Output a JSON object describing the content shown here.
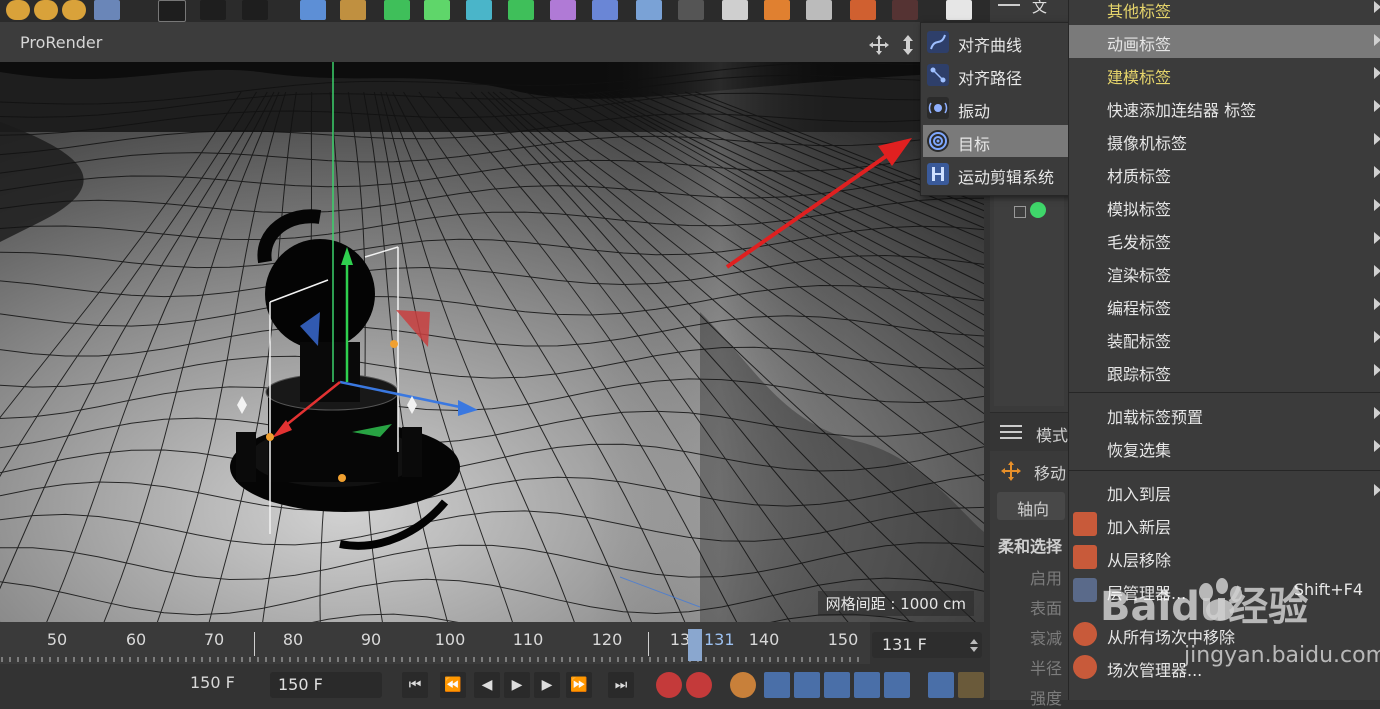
{
  "viewport": {
    "title": "ProRender",
    "grid_readout": "网格间距 : 1000 cm"
  },
  "timeline": {
    "ticks": [
      "50",
      "60",
      "70",
      "80",
      "90",
      "100",
      "110",
      "120",
      "13",
      "140",
      "150"
    ],
    "playhead_label": "131",
    "current_frame": "131 F"
  },
  "transport": {
    "end_frame": "150 F",
    "end_frame_field": "150 F"
  },
  "submenu": {
    "items": [
      {
        "label": "对齐曲线",
        "icon": "align-curve-icon"
      },
      {
        "label": "对齐路径",
        "icon": "align-path-icon"
      },
      {
        "label": "振动",
        "icon": "vibrate-icon"
      },
      {
        "label": "目标",
        "icon": "target-icon",
        "highlighted": true
      },
      {
        "label": "运动剪辑系统",
        "icon": "motion-clip-icon"
      }
    ]
  },
  "main_menu": {
    "items": [
      {
        "label": "其他标签"
      },
      {
        "label": "动画标签",
        "highlighted": true
      },
      {
        "label": "建模标签",
        "yellow": true
      },
      {
        "label": "快速添加连结器 标签"
      },
      {
        "label": "摄像机标签"
      },
      {
        "label": "材质标签"
      },
      {
        "label": "模拟标签"
      },
      {
        "label": "毛发标签"
      },
      {
        "label": "渲染标签"
      },
      {
        "label": "编程标签"
      },
      {
        "label": "装配标签"
      },
      {
        "label": "跟踪标签"
      }
    ],
    "items2": [
      {
        "label": "加载标签预置"
      },
      {
        "label": "恢复选集"
      }
    ],
    "items3": [
      {
        "label": "加入到层"
      },
      {
        "label": "加入新层"
      },
      {
        "label": "从层移除"
      },
      {
        "label": "层管理器...",
        "shortcut": "Shift+F4"
      },
      {
        "label": "从所有场次中移除"
      },
      {
        "label": "场次管理器..."
      }
    ]
  },
  "attributes": {
    "header": "模式",
    "move_label": "移动",
    "axis_button": "轴向",
    "soft_select": "柔和选择",
    "enable": "启用",
    "surface": "表面",
    "falloff": "衰减",
    "radius": "半径",
    "strength": "强度"
  },
  "toolbar": {
    "right_label": "文"
  },
  "watermark": {
    "brand": "Baidu经验",
    "url": "jingyan.baidu.com"
  },
  "colors": {
    "menu_bg": "#3b3b3b",
    "highlight": "#7a7a7a",
    "accent_yellow": "#e5d46b",
    "arrow_red": "#e02020"
  }
}
